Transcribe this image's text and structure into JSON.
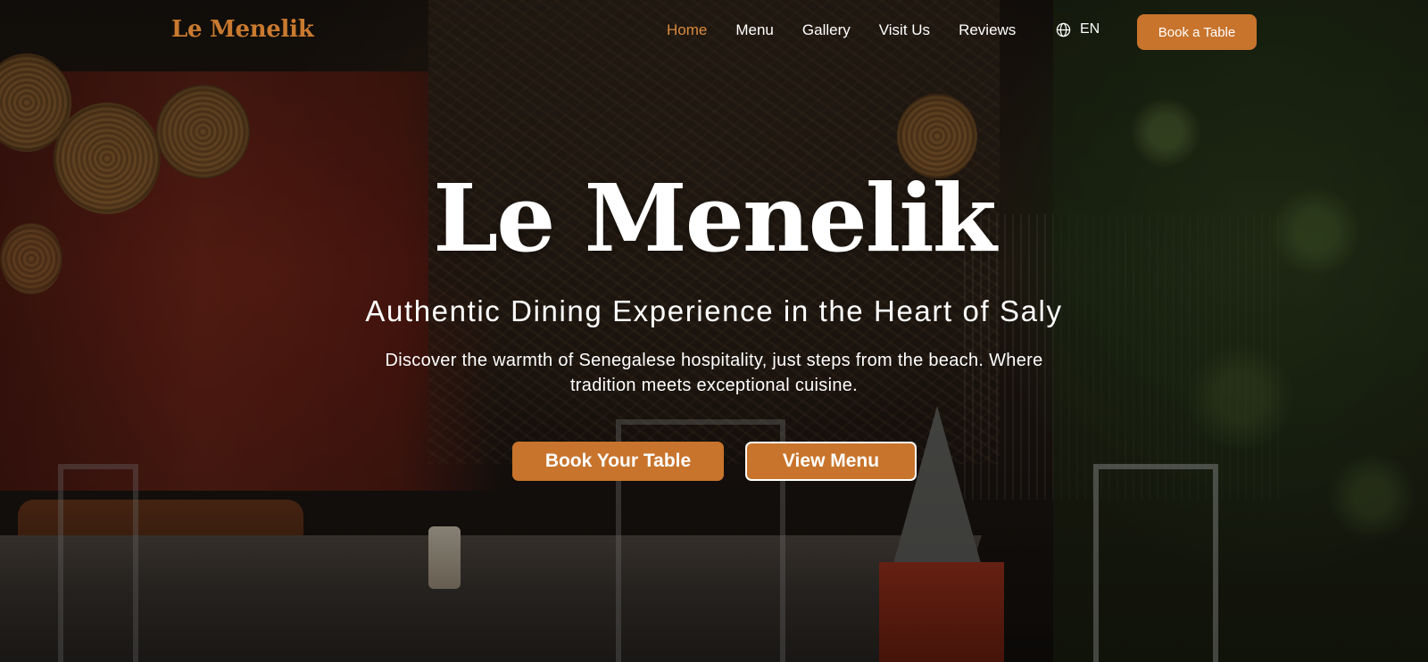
{
  "brand": {
    "name": "Le Menelik",
    "accent_color": "#c8742c"
  },
  "nav": {
    "items": [
      {
        "label": "Home",
        "active": true
      },
      {
        "label": "Menu",
        "active": false
      },
      {
        "label": "Gallery",
        "active": false
      },
      {
        "label": "Visit Us",
        "active": false
      },
      {
        "label": "Reviews",
        "active": false
      }
    ],
    "language": {
      "icon": "globe-icon",
      "label": "EN"
    },
    "cta_label": "Book a Table"
  },
  "hero": {
    "title": "Le Menelik",
    "subtitle": "Authentic Dining Experience in the Heart of Saly",
    "description": "Discover the warmth of Senegalese hospitality, just steps from the beach. Where tradition meets exceptional cuisine.",
    "primary_button": "Book Your Table",
    "secondary_button": "View Menu"
  }
}
